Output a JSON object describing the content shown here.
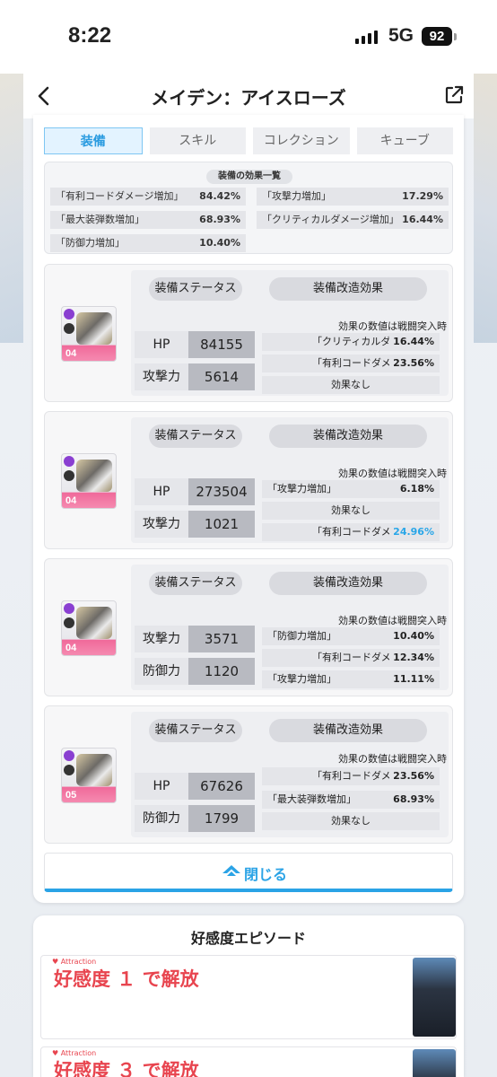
{
  "status": {
    "time": "8:22",
    "network": "5G",
    "battery": "92"
  },
  "header": {
    "title": "メイデン：アイスローズ"
  },
  "tabs": [
    "装備",
    "スキル",
    "コレクション",
    "キューブ"
  ],
  "summary": {
    "title": "装備の効果一覧",
    "effects": [
      {
        "name": "「有利コードダメージ増加」",
        "value": "84.42%"
      },
      {
        "name": "「攻撃力増加」",
        "value": "17.29%"
      },
      {
        "name": "「最大装弾数増加」",
        "value": "68.93%"
      },
      {
        "name": "「クリティカルダメージ増加」",
        "value": "16.44%"
      },
      {
        "name": "「防御力増加」",
        "value": "10.40%"
      }
    ]
  },
  "equipment": [
    {
      "level": "04",
      "status_label": "装備ステータス",
      "mod_label": "装備改造効果",
      "note": "効果の数値は戦闘突入時",
      "stats": [
        {
          "label": "HP",
          "value": "84155"
        },
        {
          "label": "攻撃力",
          "value": "5614"
        }
      ],
      "mods": [
        {
          "text": "「クリティカルダ",
          "value": "16.44%"
        },
        {
          "text": "「有利コードダメ",
          "value": "23.56%"
        },
        {
          "text": "効果なし",
          "value": ""
        }
      ]
    },
    {
      "level": "04",
      "status_label": "装備ステータス",
      "mod_label": "装備改造効果",
      "note": "効果の数値は戦闘突入時",
      "stats": [
        {
          "label": "HP",
          "value": "273504"
        },
        {
          "label": "攻撃力",
          "value": "1021"
        }
      ],
      "mods": [
        {
          "text": "「攻撃力増加」",
          "value": "6.18%"
        },
        {
          "text": "効果なし",
          "value": ""
        },
        {
          "text": "「有利コードダメ",
          "value": "24.96%"
        }
      ]
    },
    {
      "level": "04",
      "status_label": "装備ステータス",
      "mod_label": "装備改造効果",
      "note": "効果の数値は戦闘突入時",
      "stats": [
        {
          "label": "攻撃力",
          "value": "3571"
        },
        {
          "label": "防御力",
          "value": "1120"
        }
      ],
      "mods": [
        {
          "text": "「防御力増加」",
          "value": "10.40%"
        },
        {
          "text": "「有利コードダメ",
          "value": "12.34%"
        },
        {
          "text": "「攻撃力増加」",
          "value": "11.11%"
        }
      ]
    },
    {
      "level": "05",
      "status_label": "装備ステータス",
      "mod_label": "装備改造効果",
      "note": "効果の数値は戦闘突入時",
      "stats": [
        {
          "label": "HP",
          "value": "67626"
        },
        {
          "label": "防御力",
          "value": "1799"
        }
      ],
      "mods": [
        {
          "text": "「有利コードダメ",
          "value": "23.56%"
        },
        {
          "text": "「最大装弾数増加」",
          "value": "68.93%"
        },
        {
          "text": "効果なし",
          "value": ""
        }
      ]
    }
  ],
  "close_label": "閉じる",
  "episodes": {
    "title": "好感度エピソード",
    "tag": "♥ Attraction",
    "items": [
      {
        "label": "好感度 １ で解放"
      },
      {
        "label": "好感度 ３ で解放"
      }
    ]
  },
  "colors": {
    "accent": "#2aa3e6",
    "red": "#e8454f",
    "pink": "#f06a9a"
  }
}
